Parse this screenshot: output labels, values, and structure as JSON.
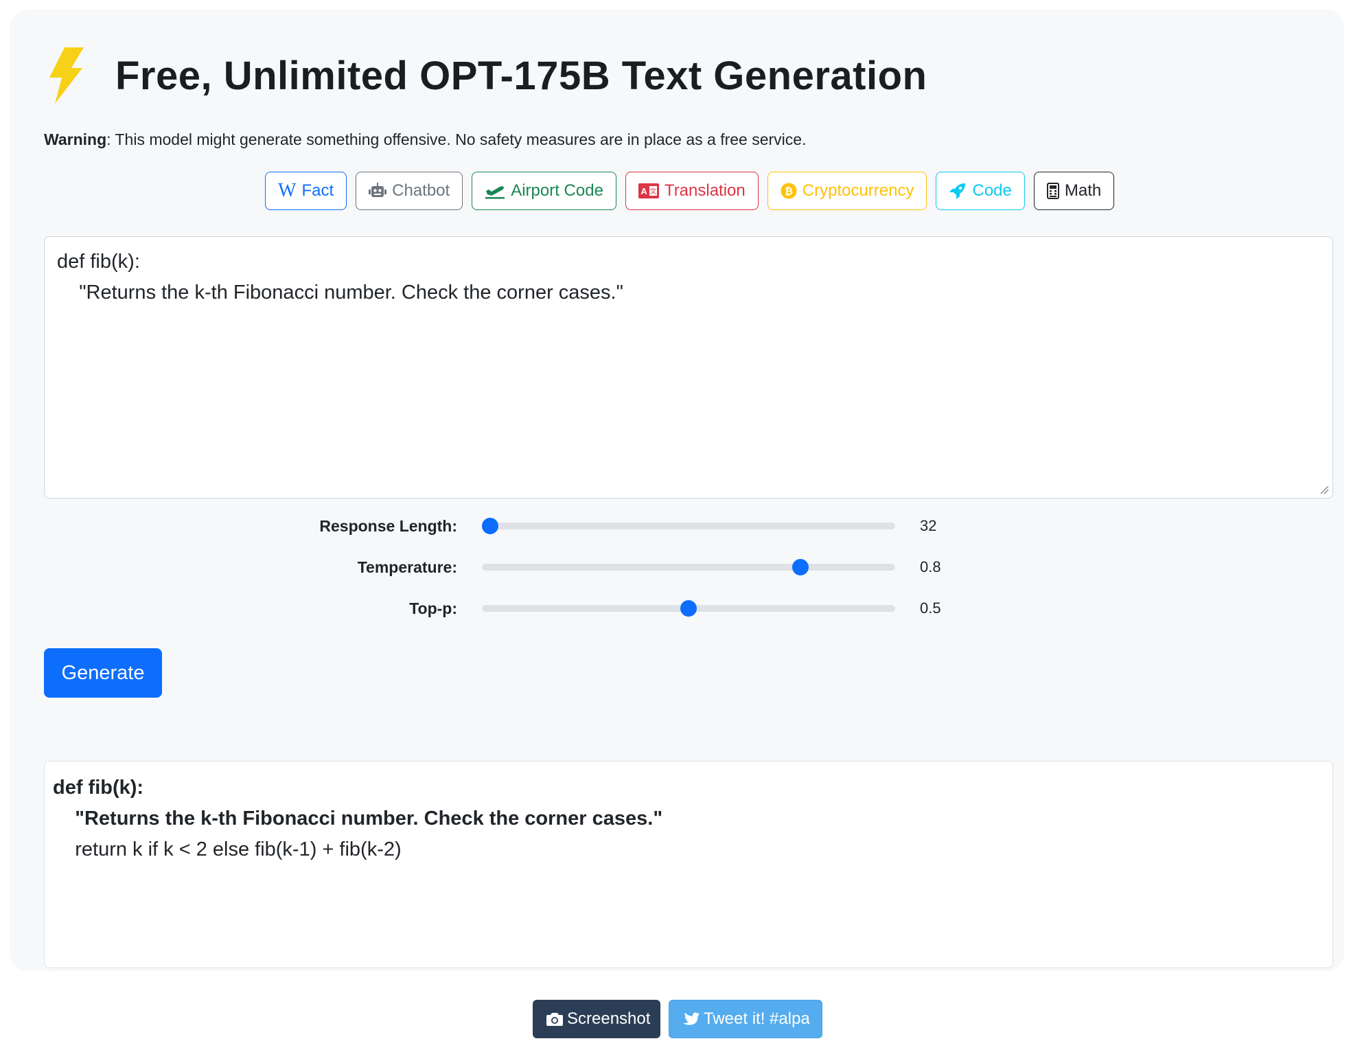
{
  "colors": {
    "primary": "#0d6efd",
    "bolt": "#f7d117"
  },
  "header": {
    "icon": "lightning-bolt-icon",
    "title": "Free, Unlimited OPT-175B Text Generation"
  },
  "warning": {
    "label": "Warning",
    "text": ": This model might generate something offensive. No safety measures are in place as a free service."
  },
  "examples": [
    {
      "label": "Fact",
      "icon": "wikipedia-icon"
    },
    {
      "label": "Chatbot",
      "icon": "robot-icon"
    },
    {
      "label": "Airport Code",
      "icon": "plane-departure-icon"
    },
    {
      "label": "Translation",
      "icon": "language-icon"
    },
    {
      "label": "Cryptocurrency",
      "icon": "bitcoin-icon"
    },
    {
      "label": "Code",
      "icon": "rocket-icon"
    },
    {
      "label": "Math",
      "icon": "calculator-icon"
    }
  ],
  "prompt": {
    "value": "def fib(k):\n    \"Returns the k-th Fibonacci number. Check the corner cases.\""
  },
  "sliders": {
    "response_length": {
      "label": "Response Length:",
      "value": "32",
      "fraction": 0.02
    },
    "temperature": {
      "label": "Temperature:",
      "value": "0.8",
      "fraction": 0.77
    },
    "top_p": {
      "label": "Top-p:",
      "value": "0.5",
      "fraction": 0.5
    }
  },
  "generate_label": "Generate",
  "output": {
    "line1": "def fib(k):",
    "line2": "    \"Returns the k-th Fibonacci number. Check the corner cases.\"",
    "line3": "    return k if k < 2 else fib(k-1) + fib(k-2)"
  },
  "footer": {
    "screenshot_label": "Screenshot",
    "tweet_label": "Tweet it! #alpa"
  }
}
